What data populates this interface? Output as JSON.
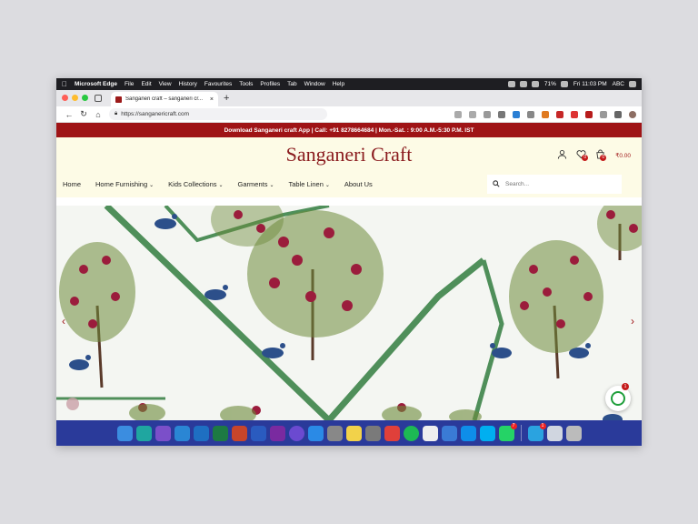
{
  "menubar": {
    "app": "Microsoft Edge",
    "items": [
      "File",
      "Edit",
      "View",
      "History",
      "Favourites",
      "Tools",
      "Profiles",
      "Tab",
      "Window",
      "Help"
    ],
    "battery": "71%",
    "clock": "Fri 11:03 PM",
    "input": "ABC"
  },
  "browser": {
    "tab_title": "Sanganeri craft – sanganeri cr...",
    "url": "https://sanganericraft.com"
  },
  "site": {
    "announcement": "Download Sanganeri craft App  |  Call: +91 8278664684 | Mon.-Sat. : 9:00 A.M.-5:30 P.M. IST",
    "logo": "Sanganeri Craft",
    "wishlist_count": "0",
    "cart_count": "0",
    "cart_total": "₹0.00",
    "nav": [
      {
        "label": "Home",
        "dropdown": false
      },
      {
        "label": "Home Furnishing",
        "dropdown": true
      },
      {
        "label": "Kids Collections",
        "dropdown": true
      },
      {
        "label": "Garments",
        "dropdown": true
      },
      {
        "label": "Table Linen",
        "dropdown": true
      },
      {
        "label": "About Us",
        "dropdown": false
      }
    ],
    "search_placeholder": "Search...",
    "whatsapp_badge": "1"
  },
  "colors": {
    "brand": "#9f1416",
    "cream": "#fdfbe6",
    "fabric_green": "#4f8f5a",
    "pomegranate": "#9b1c3c"
  },
  "dock": {
    "apps": [
      "finder",
      "edge",
      "visual-studio",
      "vscode",
      "outlook",
      "excel",
      "powerpoint",
      "word",
      "onenote",
      "siri",
      "app-store",
      "launchpad",
      "notes",
      "system-preferences",
      "anydesk",
      "spotify",
      "textedit",
      "xcode",
      "teamviewer",
      "skype",
      "whatsapp",
      "telegram",
      "preview",
      "trash"
    ],
    "badges": {
      "whatsapp": "7",
      "telegram": "1"
    }
  }
}
